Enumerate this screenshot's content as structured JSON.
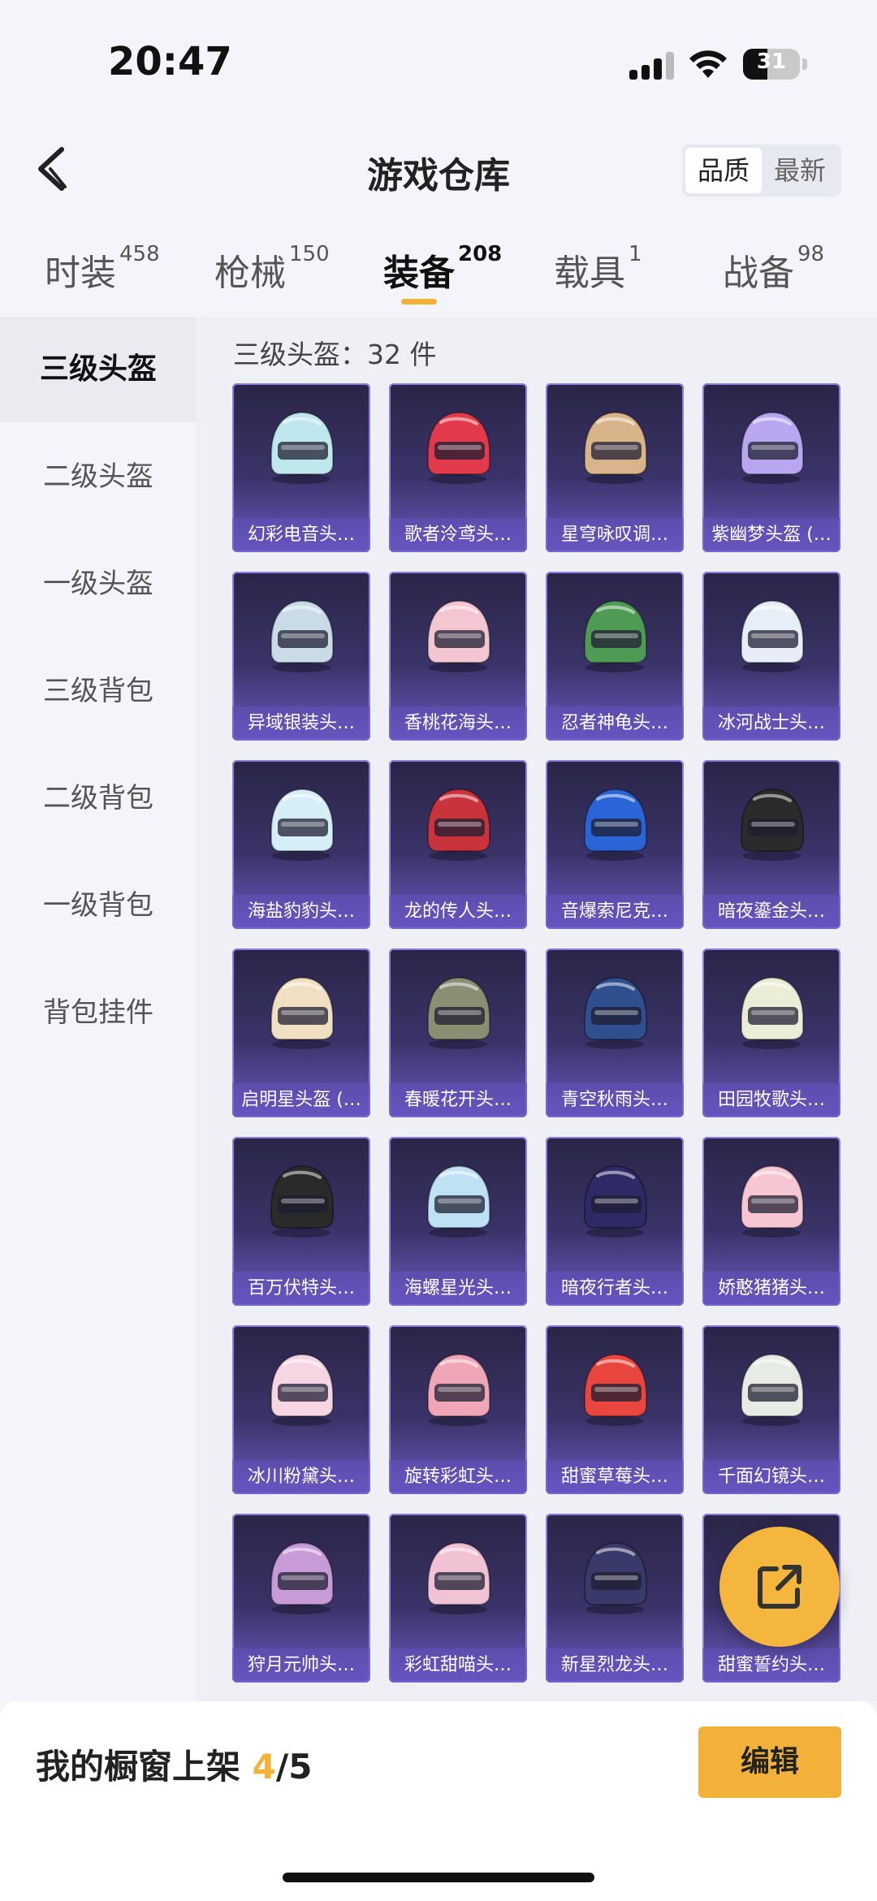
{
  "status_bar": {
    "time": "20:47",
    "battery": "31"
  },
  "header": {
    "title": "游戏仓库",
    "sort_options": [
      "品质",
      "最新"
    ],
    "sort_selected": "品质"
  },
  "tabs": [
    {
      "label": "时装",
      "count": "458"
    },
    {
      "label": "枪械",
      "count": "150"
    },
    {
      "label": "装备",
      "count": "208",
      "active": true
    },
    {
      "label": "载具",
      "count": "1"
    },
    {
      "label": "战备",
      "count": "98"
    }
  ],
  "sidebar": {
    "items": [
      "三级头盔",
      "二级头盔",
      "一级头盔",
      "三级背包",
      "二级背包",
      "一级背包",
      "背包挂件"
    ],
    "selected": "三级头盔"
  },
  "content": {
    "count_label": "三级头盔：32 件",
    "items": [
      "幻彩电音头…",
      "歌者泠鸢头…",
      "星穹咏叹调…",
      "紫幽梦头盔 (…",
      "异域银装头…",
      "香桃花海头…",
      "忍者神龟头…",
      "冰河战士头…",
      "海盐豹豹头…",
      "龙的传人头…",
      "音爆索尼克…",
      "暗夜鎏金头…",
      "启明星头盔 (…",
      "春暖花开头…",
      "青空秋雨头…",
      "田园牧歌头…",
      "百万伏特头…",
      "海螺星光头…",
      "暗夜行者头…",
      "娇憨猪猪头…",
      "冰川粉黛头…",
      "旋转彩虹头…",
      "甜蜜草莓头…",
      "千面幻镜头…",
      "狩月元帅头…",
      "彩虹甜喵头…",
      "新星烈龙头…",
      "甜蜜誓约头…"
    ],
    "helmet_colors": [
      "#bfe7ee",
      "#e23a4a",
      "#d9b48a",
      "#b9a6f0",
      "#c8dbe6",
      "#f3c6d2",
      "#4f9a55",
      "#e8eef8",
      "#d6eef8",
      "#c9333c",
      "#2a64d6",
      "#2b2b2b",
      "#f0dfc2",
      "#8a8f74",
      "#2f4f8f",
      "#ecedd6",
      "#2a2a2a",
      "#bfe1f4",
      "#2e2a66",
      "#f6c7d3",
      "#f6d6e2",
      "#f1a6b8",
      "#e8463e",
      "#e6ebe6",
      "#c79ad8",
      "#f0c2d4",
      "#3a3a6a",
      "#d8c2e6"
    ]
  },
  "bottom_bar": {
    "label": "我的橱窗上架",
    "shelf_count": "4",
    "shelf_total": "/5",
    "edit_label": "编辑"
  }
}
